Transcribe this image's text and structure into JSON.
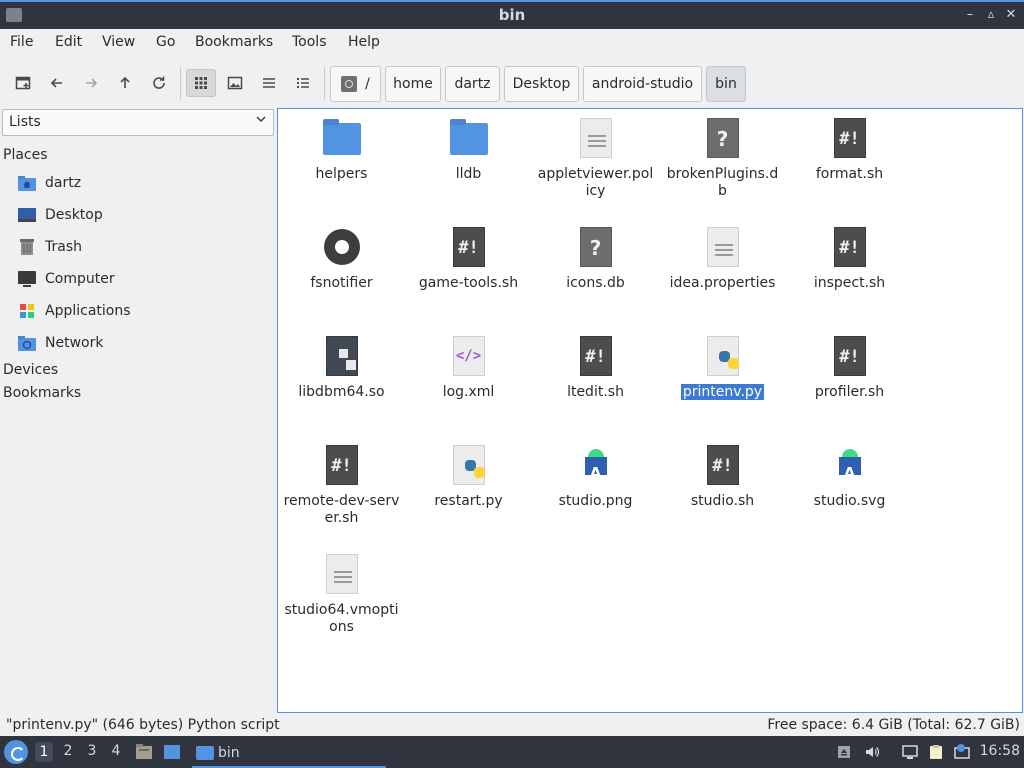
{
  "window": {
    "title": "bin",
    "min_label": "–",
    "max_label": "▵",
    "close_label": "✕"
  },
  "menu": [
    "File",
    "Edit",
    "View",
    "Go",
    "Bookmarks",
    "Tools",
    "Help"
  ],
  "breadcrumb": {
    "root": "/",
    "segments": [
      "home",
      "dartz",
      "Desktop",
      "android-studio",
      "bin"
    ]
  },
  "sidebar": {
    "select_value": "Lists",
    "headings": {
      "places": "Places",
      "devices": "Devices",
      "bookmarks": "Bookmarks"
    },
    "places": [
      {
        "label": "dartz",
        "icon": "home-folder-icon"
      },
      {
        "label": "Desktop",
        "icon": "desktop-icon"
      },
      {
        "label": "Trash",
        "icon": "trash-icon"
      },
      {
        "label": "Computer",
        "icon": "computer-icon"
      },
      {
        "label": "Applications",
        "icon": "applications-icon"
      },
      {
        "label": "Network",
        "icon": "network-icon"
      }
    ]
  },
  "files": [
    {
      "name": "helpers",
      "type": "folder"
    },
    {
      "name": "lldb",
      "type": "folder"
    },
    {
      "name": "appletviewer.policy",
      "type": "text"
    },
    {
      "name": "brokenPlugins.db",
      "type": "unknown"
    },
    {
      "name": "format.sh",
      "type": "script"
    },
    {
      "name": "fsnotifier",
      "type": "executable"
    },
    {
      "name": "game-tools.sh",
      "type": "script"
    },
    {
      "name": "icons.db",
      "type": "unknown"
    },
    {
      "name": "idea.properties",
      "type": "text"
    },
    {
      "name": "inspect.sh",
      "type": "script"
    },
    {
      "name": "libdbm64.so",
      "type": "library"
    },
    {
      "name": "log.xml",
      "type": "xml"
    },
    {
      "name": "ltedit.sh",
      "type": "script"
    },
    {
      "name": "printenv.py",
      "type": "python",
      "selected": true
    },
    {
      "name": "profiler.sh",
      "type": "script"
    },
    {
      "name": "remote-dev-server.sh",
      "type": "script"
    },
    {
      "name": "restart.py",
      "type": "python"
    },
    {
      "name": "studio.png",
      "type": "studio-image"
    },
    {
      "name": "studio.sh",
      "type": "script"
    },
    {
      "name": "studio.svg",
      "type": "studio-image"
    },
    {
      "name": "studio64.vmoptions",
      "type": "text"
    }
  ],
  "status": {
    "left": "\"printenv.py\" (646 bytes) Python script",
    "right": "Free space: 6.4 GiB (Total: 62.7 GiB)"
  },
  "taskbar": {
    "workspaces": [
      "1",
      "2",
      "3",
      "4"
    ],
    "active_workspace": "1",
    "task_label": "bin",
    "clock": "16:58"
  },
  "colors": {
    "accent": "#5294e2",
    "titlebar": "#2f343f",
    "selection": "#3c7ad6"
  }
}
